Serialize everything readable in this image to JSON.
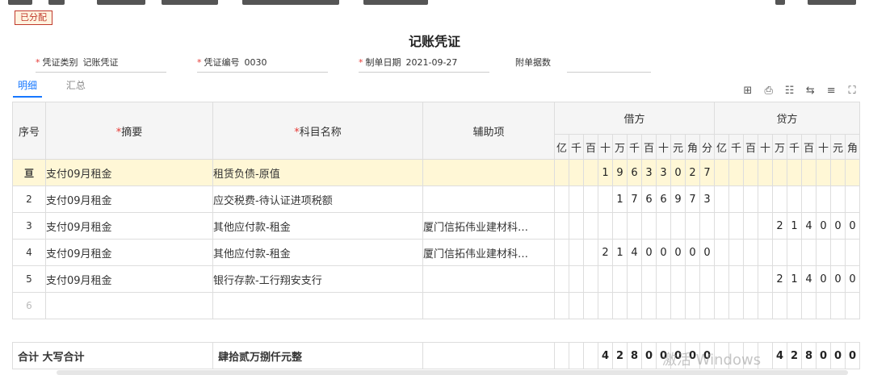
{
  "status_badge": "已分配",
  "title": "记账凭证",
  "fields": {
    "voucher_type_label": "凭证类别",
    "voucher_type_value": "记账凭证",
    "voucher_no_label": "凭证编号",
    "voucher_no_value": "0030",
    "date_label": "制单日期",
    "date_value": "2021-09-27",
    "attachments_label": "附单据数",
    "attachments_value": ""
  },
  "tabs": [
    {
      "label": "明细",
      "active": true
    },
    {
      "label": "汇总",
      "active": false
    }
  ],
  "toolbar_icons": [
    "grid-icon",
    "print-icon",
    "layout-icon",
    "transfer-icon",
    "adjust-icon",
    "fullscreen-icon"
  ],
  "table": {
    "headers": {
      "seq": "序号",
      "summary": "摘要",
      "account": "科目名称",
      "aux": "辅助项",
      "debit": "借方",
      "credit": "贷方"
    },
    "debit_digit_headers": [
      "亿",
      "千",
      "百",
      "十",
      "万",
      "千",
      "百",
      "十",
      "元",
      "角",
      "分"
    ],
    "credit_digit_headers": [
      "亿",
      "千",
      "百",
      "十",
      "万",
      "千",
      "百",
      "十",
      "元",
      "角"
    ],
    "rows": [
      {
        "seq": "亘",
        "summary": "支付09月租金",
        "account": "租赁负债-原值",
        "aux": "",
        "debit": [
          "",
          "",
          "",
          "1",
          "9",
          "6",
          "3",
          "3",
          "0",
          "2",
          "7"
        ],
        "credit": [
          "",
          "",
          "",
          "",
          "",
          "",
          "",
          "",
          "",
          ""
        ]
      },
      {
        "seq": "2",
        "summary": "支付09月租金",
        "account": "应交税费-待认证进项税额",
        "aux": "",
        "debit": [
          "",
          "",
          "",
          "",
          "1",
          "7",
          "6",
          "6",
          "9",
          "7",
          "3"
        ],
        "credit": [
          "",
          "",
          "",
          "",
          "",
          "",
          "",
          "",
          "",
          ""
        ]
      },
      {
        "seq": "3",
        "summary": "支付09月租金",
        "account": "其他应付款-租金",
        "aux": "厦门信拓伟业建材科…",
        "debit": [
          "",
          "",
          "",
          "",
          "",
          "",
          "",
          "",
          "",
          "",
          ""
        ],
        "credit": [
          "",
          "",
          "",
          "",
          "2",
          "1",
          "4",
          "0",
          "0",
          "0"
        ]
      },
      {
        "seq": "4",
        "summary": "支付09月租金",
        "account": "其他应付款-租金",
        "aux": "厦门信拓伟业建材科…",
        "debit": [
          "",
          "",
          "",
          "2",
          "1",
          "4",
          "0",
          "0",
          "0",
          "0",
          "0"
        ],
        "credit": [
          "",
          "",
          "",
          "",
          "",
          "",
          "",
          "",
          "",
          ""
        ]
      },
      {
        "seq": "5",
        "summary": "支付09月租金",
        "account": "银行存款-工行翔安支行",
        "aux": "",
        "debit": [
          "",
          "",
          "",
          "",
          "",
          "",
          "",
          "",
          "",
          "",
          ""
        ],
        "credit": [
          "",
          "",
          "",
          "",
          "2",
          "1",
          "4",
          "0",
          "0",
          "0"
        ]
      },
      {
        "seq": "6",
        "summary": "",
        "account": "",
        "aux": "",
        "debit": [
          "",
          "",
          "",
          "",
          "",
          "",
          "",
          "",
          "",
          "",
          ""
        ],
        "credit": [
          "",
          "",
          "",
          "",
          "",
          "",
          "",
          "",
          "",
          ""
        ]
      }
    ],
    "total": {
      "label": "合计 大写合计",
      "amount_words": "肆拾贰万捌仟元整",
      "debit": [
        "",
        "",
        "",
        "4",
        "2",
        "8",
        "0",
        "0",
        "0",
        "0",
        "0"
      ],
      "credit": [
        "",
        "",
        "",
        "",
        "4",
        "2",
        "8",
        "0",
        "0",
        "0"
      ]
    }
  },
  "watermark": "激活 Windows"
}
